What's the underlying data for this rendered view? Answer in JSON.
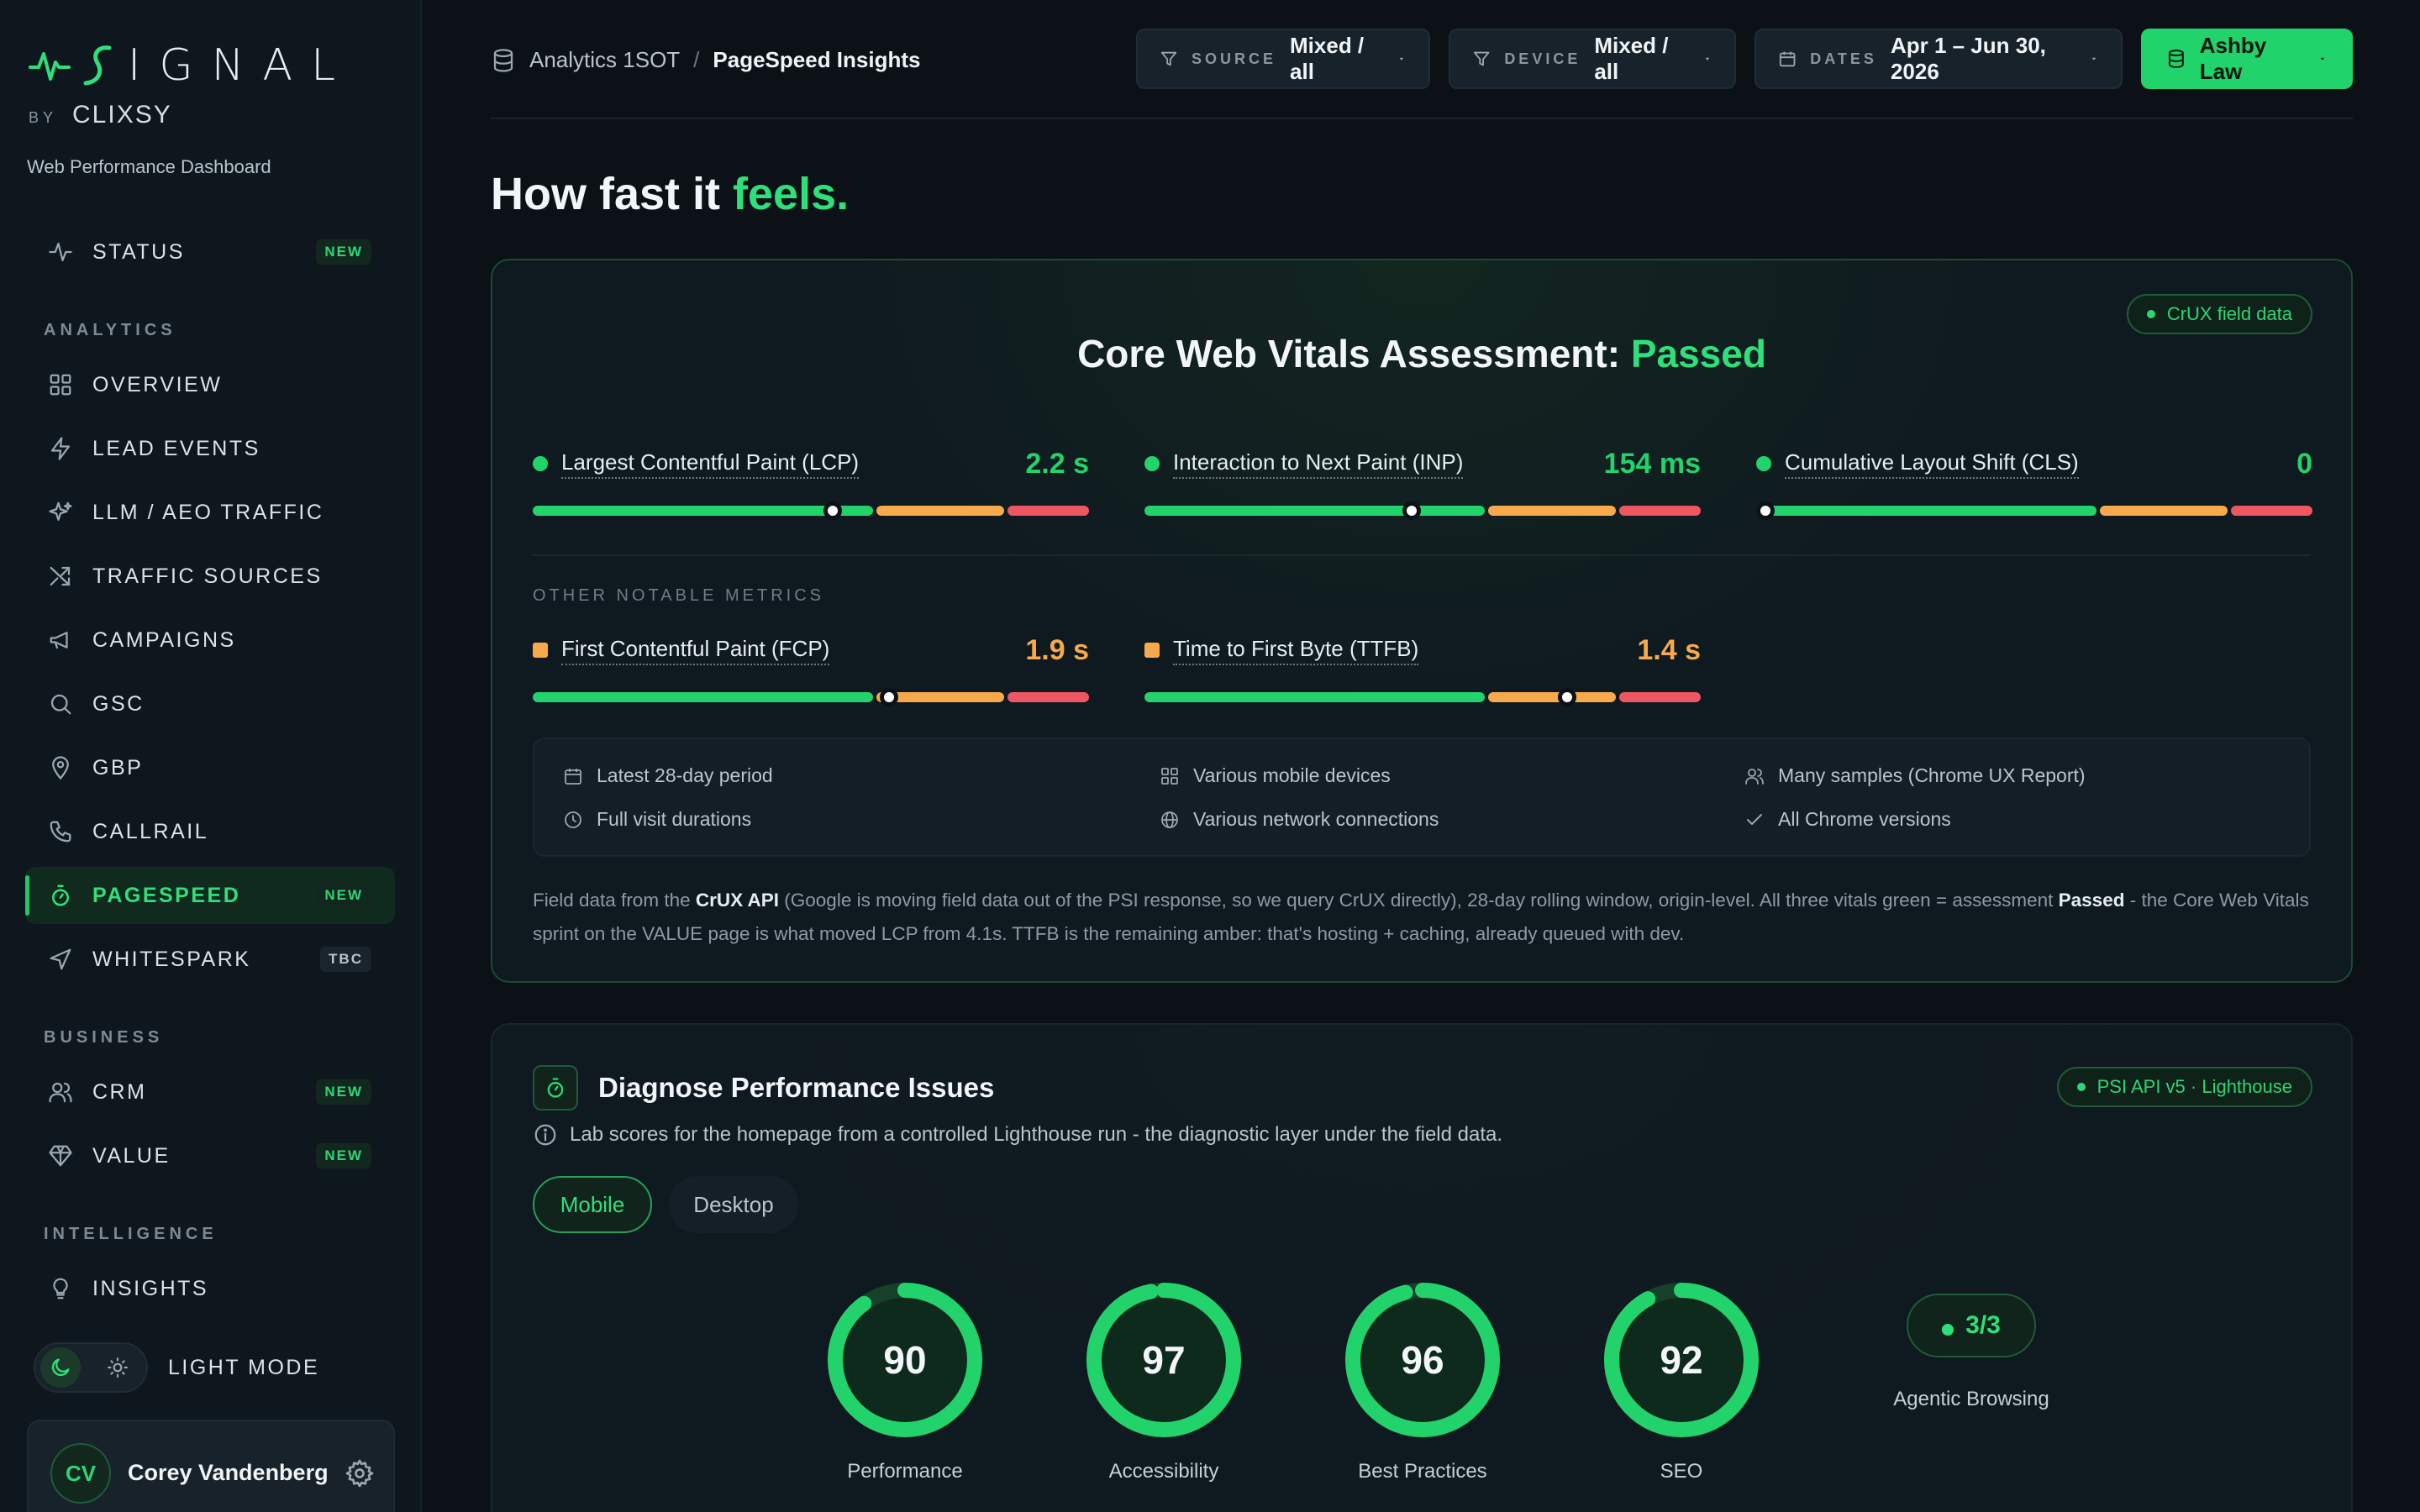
{
  "brand": {
    "word": "IGNAL",
    "by": "BY",
    "partner": "CLIXSY",
    "subtitle": "Web Performance Dashboard"
  },
  "nav": {
    "status": {
      "label": "STATUS",
      "badge": "NEW"
    },
    "section_analytics": "ANALYTICS",
    "overview": {
      "label": "OVERVIEW"
    },
    "lead_events": {
      "label": "LEAD EVENTS"
    },
    "llm_traffic": {
      "label": "LLM / AEO TRAFFIC"
    },
    "traffic_sources": {
      "label": "TRAFFIC SOURCES"
    },
    "campaigns": {
      "label": "CAMPAIGNS"
    },
    "gsc": {
      "label": "GSC"
    },
    "gbp": {
      "label": "GBP"
    },
    "callrail": {
      "label": "CALLRAIL"
    },
    "pagespeed": {
      "label": "PAGESPEED",
      "badge": "NEW"
    },
    "whitespark": {
      "label": "WHITESPARK",
      "badge": "TBC"
    },
    "section_business": "BUSINESS",
    "crm": {
      "label": "CRM",
      "badge": "NEW"
    },
    "value": {
      "label": "VALUE",
      "badge": "NEW"
    },
    "section_intelligence": "INTELLIGENCE",
    "insights": {
      "label": "INSIGHTS"
    },
    "theme_label": "LIGHT MODE"
  },
  "user": {
    "initials": "CV",
    "name": "Corey Vandenberg"
  },
  "breadcrumb": {
    "parent": "Analytics 1SOT",
    "separator": "/",
    "current": "PageSpeed Insights"
  },
  "filters": {
    "source": {
      "key": "SOURCE",
      "value": "Mixed / all"
    },
    "device": {
      "key": "DEVICE",
      "value": "Mixed / all"
    },
    "dates": {
      "key": "DATES",
      "value": "Apr 1 – Jun 30, 2026"
    },
    "client": {
      "value": "Ashby Law"
    }
  },
  "page_title": {
    "main": "How fast it",
    "accent": "feels."
  },
  "cwv": {
    "pill": "CrUX field data",
    "title": "Core Web Vitals Assessment:",
    "status": "Passed",
    "other_label": "OTHER NOTABLE METRICS",
    "metrics": [
      {
        "name": "Largest Contentful Paint (LCP)",
        "value": "2.2 s",
        "status": "good",
        "position": 0.54
      },
      {
        "name": "Interaction to Next Paint (INP)",
        "value": "154 ms",
        "status": "good",
        "position": 0.48
      },
      {
        "name": "Cumulative Layout Shift (CLS)",
        "value": "0",
        "status": "good",
        "position": 0.0
      },
      {
        "name": "First Contentful Paint (FCP)",
        "value": "1.9 s",
        "status": "needs-improvement",
        "position": 0.64
      },
      {
        "name": "Time to First Byte (TTFB)",
        "value": "1.4 s",
        "status": "needs-improvement",
        "position": 0.76
      }
    ],
    "info": {
      "period": "Latest 28-day period",
      "devices": "Various mobile devices",
      "samples": "Many samples (Chrome UX Report)",
      "durations": "Full visit durations",
      "network": "Various network connections",
      "versions": "All Chrome versions"
    },
    "note": {
      "p1": "Field data from the ",
      "b1": "CrUX API",
      "p2": " (Google is moving field data out of the PSI response, so we query CrUX directly), 28-day rolling window, origin-level. All three vitals green = assessment ",
      "b2": "Passed",
      "p3": " - the Core Web Vitals sprint on the VALUE page is what moved LCP from 4.1s. TTFB is the remaining amber: that's hosting + caching, already queued with dev."
    }
  },
  "diagnose": {
    "title": "Diagnose Performance Issues",
    "pill": "PSI API v5 · Lighthouse",
    "subtitle": "Lab scores for the homepage from a controlled Lighthouse run - the diagnostic layer under the field data.",
    "tabs": {
      "mobile": "Mobile",
      "desktop": "Desktop"
    },
    "scores": [
      {
        "label": "Performance",
        "value": 90
      },
      {
        "label": "Accessibility",
        "value": 97
      },
      {
        "label": "Best Practices",
        "value": 96
      },
      {
        "label": "SEO",
        "value": 92
      }
    ],
    "agentic": {
      "label": "Agentic Browsing",
      "value": "3/3"
    }
  },
  "colors": {
    "good": "#22d36b",
    "warn": "#f7a94c",
    "bad": "#ee5662",
    "accent": "#2fe07a"
  }
}
